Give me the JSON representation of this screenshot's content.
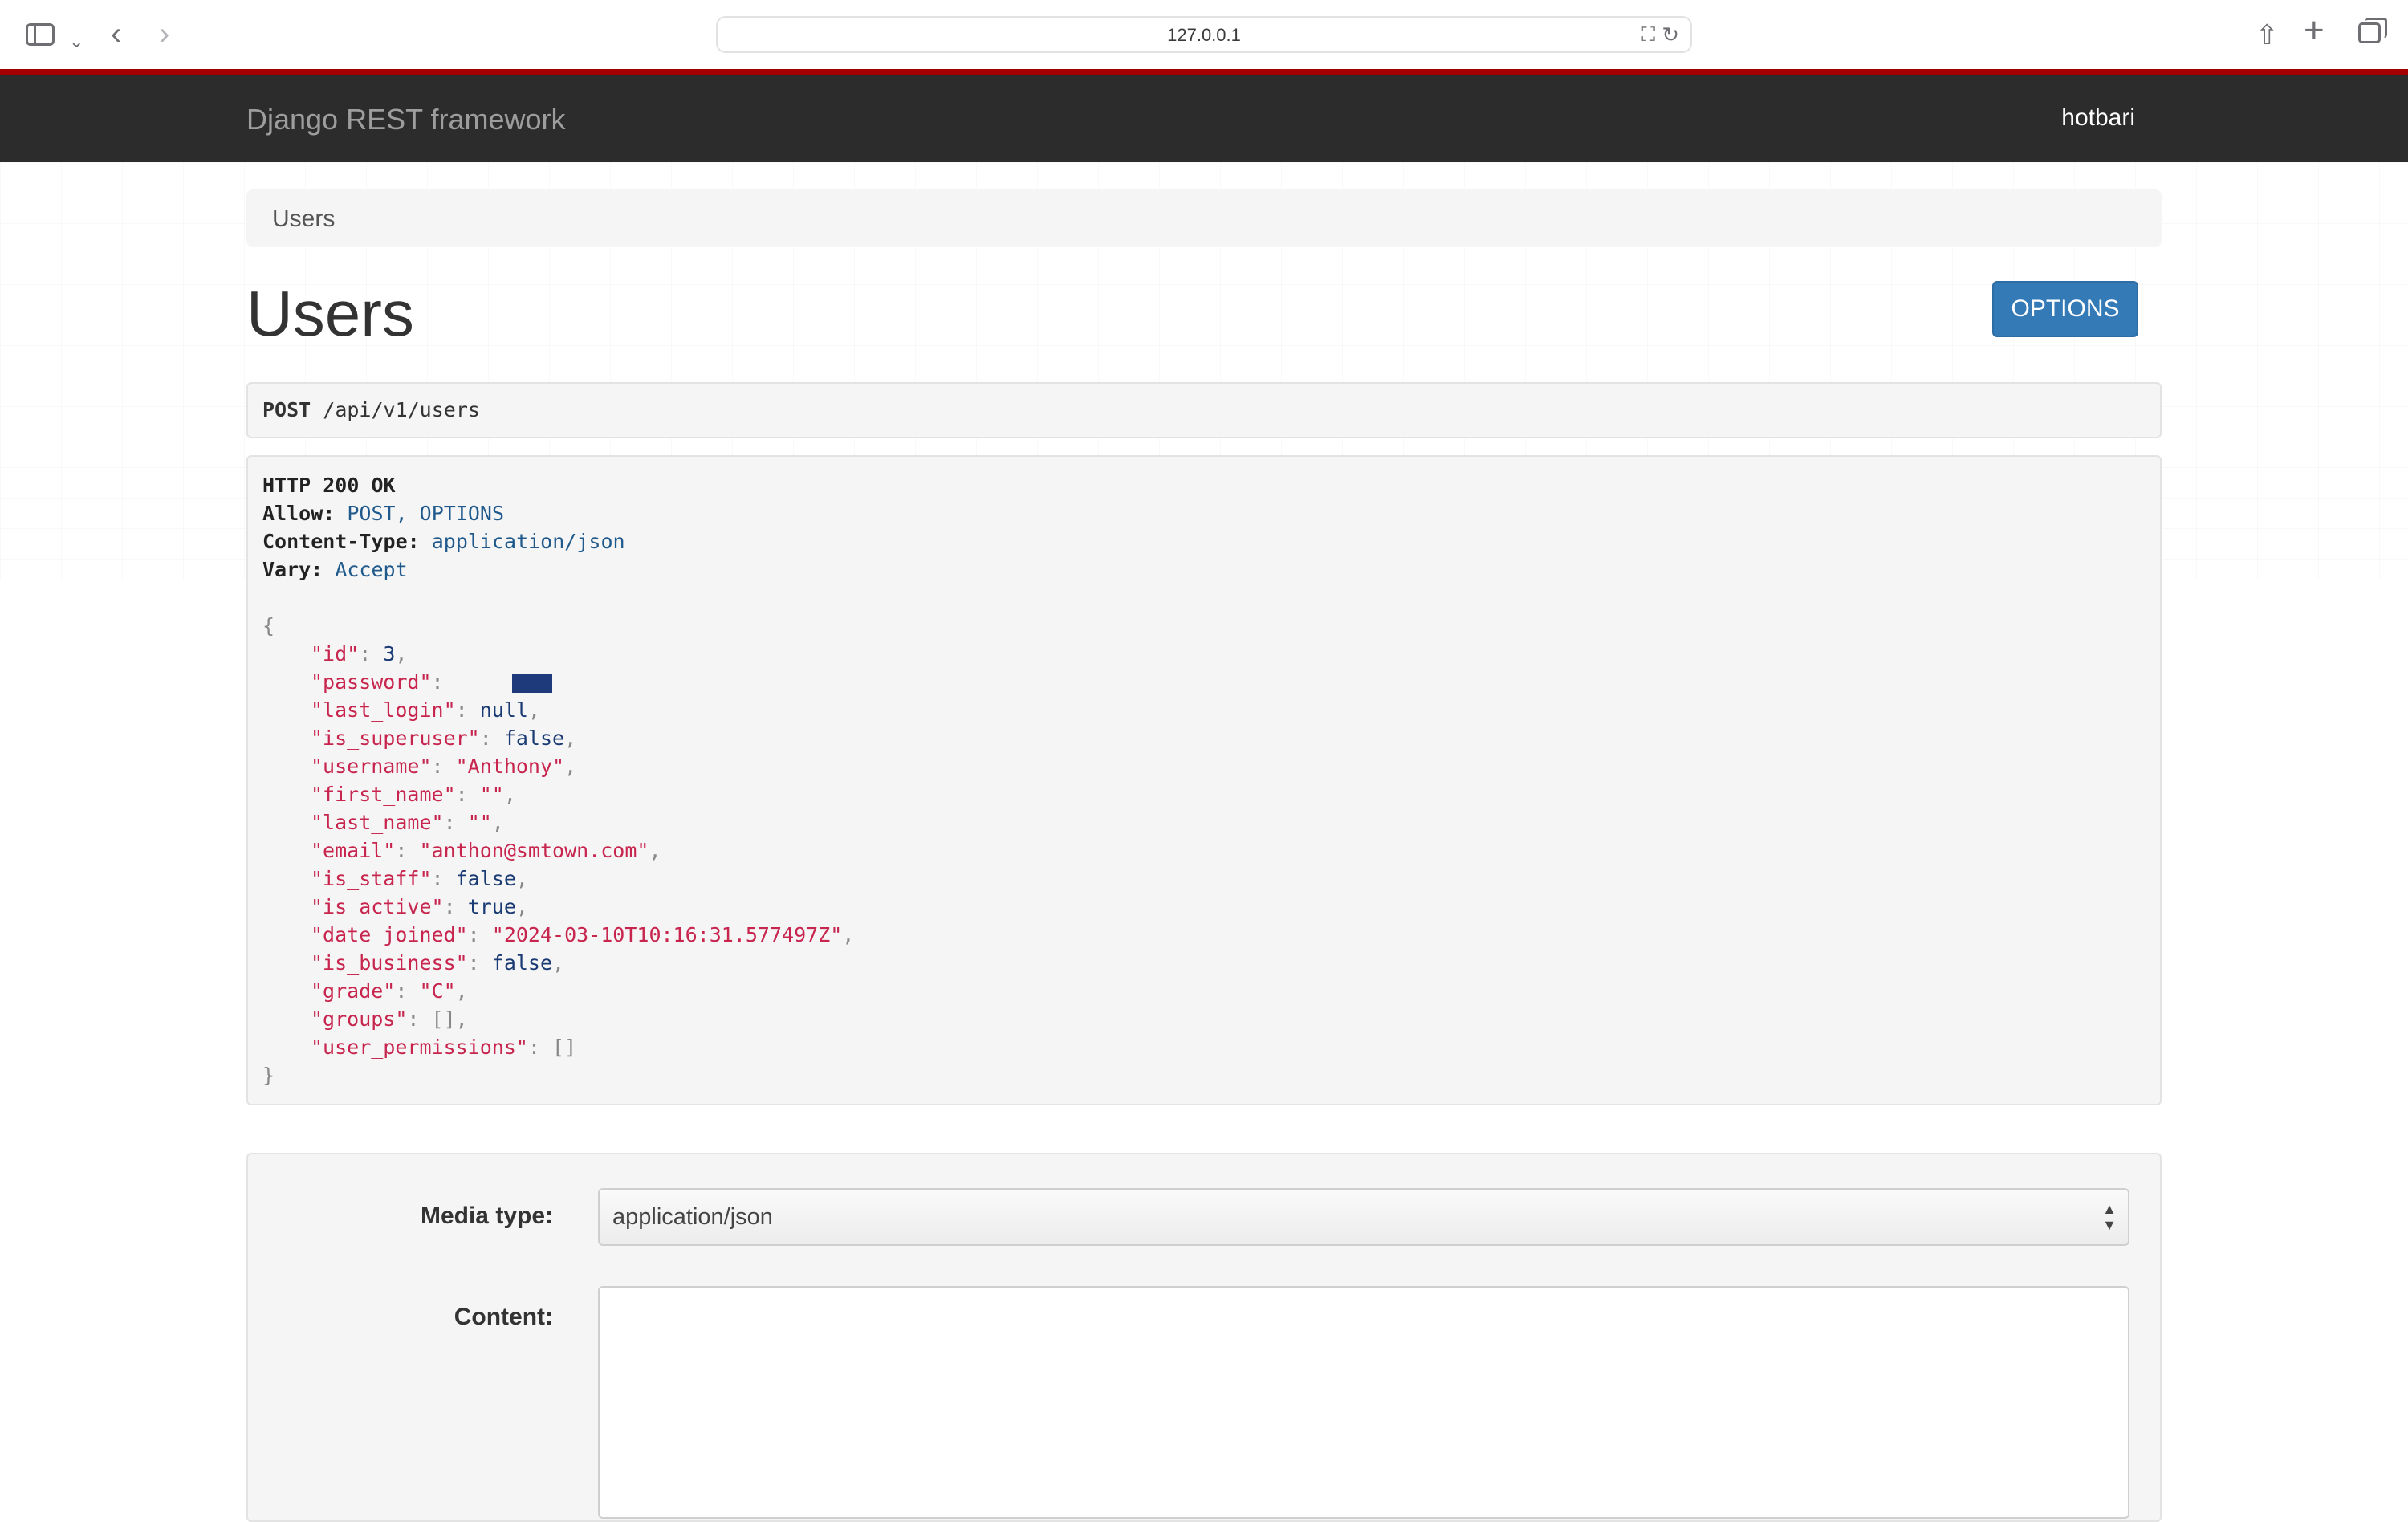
{
  "browser": {
    "url": "127.0.0.1",
    "icons": {
      "sidebar": "sidebar-icon",
      "back": "chevron-left-icon",
      "forward": "chevron-right-icon",
      "share": "share-icon",
      "new_tab": "plus-icon",
      "tabs": "tabs-overview-icon"
    }
  },
  "navbar": {
    "brand": "Django REST framework",
    "user": "hotbari",
    "accent_color": "#a30000"
  },
  "breadcrumb": "Users",
  "page": {
    "title": "Users",
    "options_label": "OPTIONS"
  },
  "request": {
    "method": "POST",
    "path": " /api/v1/users"
  },
  "response": {
    "status": "HTTP 200 OK",
    "headers": [
      {
        "key": "Allow:",
        "value": " POST, OPTIONS"
      },
      {
        "key": "Content-Type:",
        "value": " application/json"
      },
      {
        "key": "Vary:",
        "value": " Accept"
      }
    ],
    "open_brace": "{",
    "close_brace": "}",
    "fields": [
      {
        "key": "\"id\"",
        "value": "3",
        "type": "lit"
      },
      {
        "key": "\"password\"",
        "value": "",
        "type": "redacted"
      },
      {
        "key": "\"last_login\"",
        "value": "null",
        "type": "lit"
      },
      {
        "key": "\"is_superuser\"",
        "value": "false",
        "type": "lit"
      },
      {
        "key": "\"username\"",
        "value": "\"Anthony\"",
        "type": "str"
      },
      {
        "key": "\"first_name\"",
        "value": "\"\"",
        "type": "str"
      },
      {
        "key": "\"last_name\"",
        "value": "\"\"",
        "type": "str"
      },
      {
        "key": "\"email\"",
        "value": "\"anthon@smtown.com\"",
        "type": "str"
      },
      {
        "key": "\"is_staff\"",
        "value": "false",
        "type": "lit"
      },
      {
        "key": "\"is_active\"",
        "value": "true",
        "type": "lit"
      },
      {
        "key": "\"date_joined\"",
        "value": "\"2024-03-10T10:16:31.577497Z\"",
        "type": "str"
      },
      {
        "key": "\"is_business\"",
        "value": "false",
        "type": "lit"
      },
      {
        "key": "\"grade\"",
        "value": "\"C\"",
        "type": "str"
      },
      {
        "key": "\"groups\"",
        "value": "[]",
        "type": "punc"
      },
      {
        "key": "\"user_permissions\"",
        "value": "[]",
        "type": "punc",
        "last": true
      }
    ]
  },
  "form": {
    "media_type_label": "Media type:",
    "media_type_value": "application/json",
    "content_label": "Content:",
    "content_value": ""
  }
}
